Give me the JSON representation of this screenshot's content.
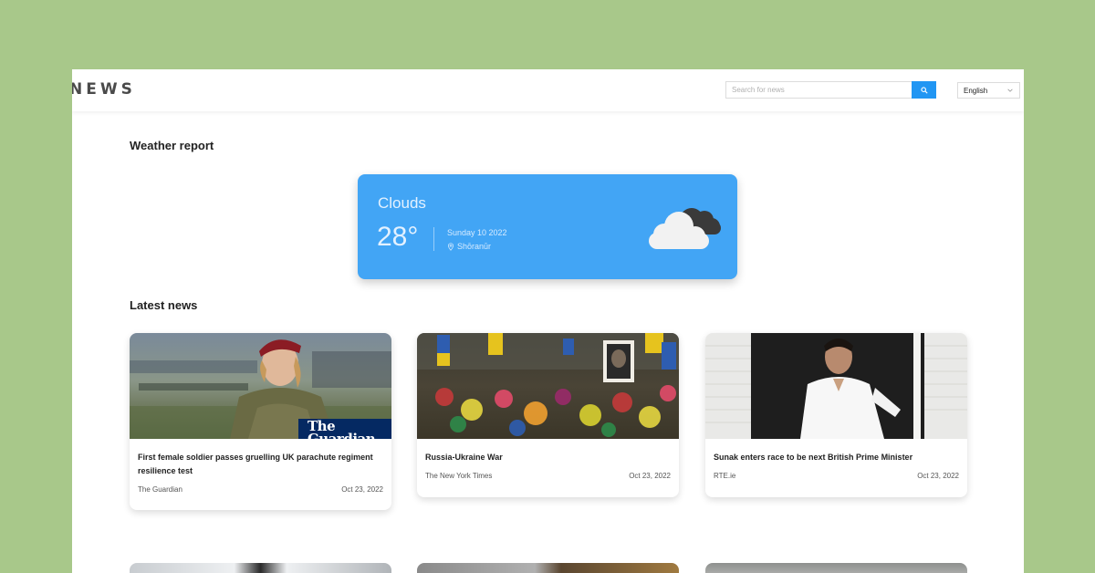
{
  "app": {
    "logo": "NEWS"
  },
  "search": {
    "placeholder": "Search for news"
  },
  "language": {
    "selected": "English"
  },
  "sections": {
    "weather_title": "Weather report",
    "latest_title": "Latest news"
  },
  "weather": {
    "condition": "Clouds",
    "temperature": "28°",
    "date": "Sunday 10 2022",
    "location": "Shōranūr",
    "icon": "cloud-icon",
    "card_color": "#42a5f5"
  },
  "news": [
    {
      "title": "First female soldier passes gruelling UK parachute regiment resilience test",
      "source": "The Guardian",
      "date": "Oct 23, 2022",
      "image_label": "The Guardian"
    },
    {
      "title": "Russia-Ukraine War",
      "source": "The New York Times",
      "date": "Oct 23, 2022"
    },
    {
      "title": "Sunak enters race to be next British Prime Minister",
      "source": "RTE.ie",
      "date": "Oct 23, 2022"
    }
  ],
  "colors": {
    "accent": "#2196f3",
    "page_background": "#a8c88a"
  }
}
